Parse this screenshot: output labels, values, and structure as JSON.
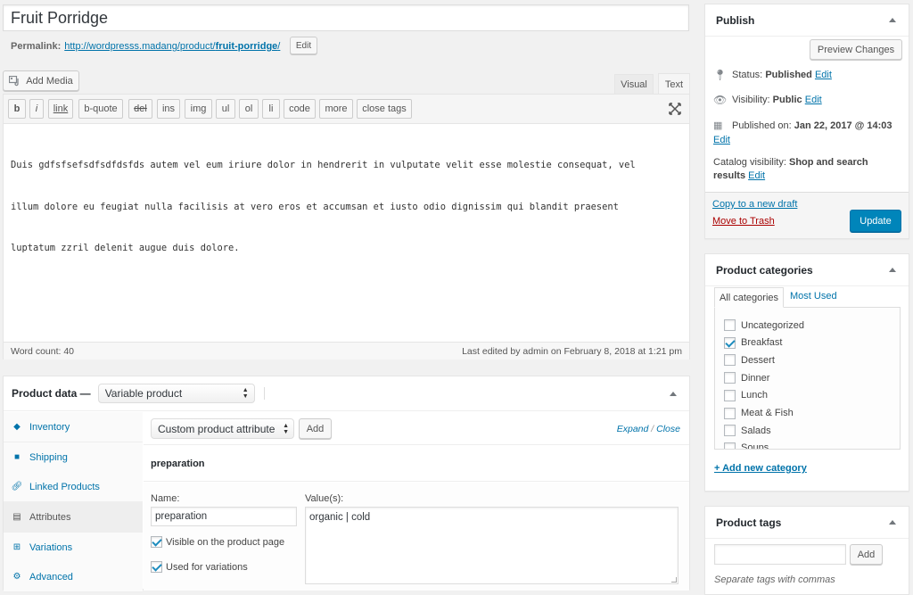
{
  "title_input": {
    "value": "Fruit Porridge"
  },
  "permalink": {
    "label": "Permalink:",
    "url_base": "http://wordpresss.madang/product/",
    "slug": "fruit-porridge",
    "trailing": "/",
    "edit_label": "Edit"
  },
  "editor": {
    "add_media_label": "Add Media",
    "tabs": [
      {
        "label": "Visual",
        "active": false
      },
      {
        "label": "Text",
        "active": true
      }
    ],
    "quicktags": [
      "b",
      "i",
      "link",
      "b-quote",
      "del",
      "ins",
      "img",
      "ul",
      "ol",
      "li",
      "code",
      "more",
      "close tags"
    ],
    "content_lines": [
      "Duis gdfsfsefsdfsdfdsfds autem vel eum iriure dolor in hendrerit in vulputate velit esse molestie consequat, vel",
      "illum dolore eu feugiat nulla facilisis at vero eros et accumsan et iusto odio dignissim qui blandit praesent",
      "luptatum zzril delenit augue duis dolore."
    ],
    "word_count": "Word count: 40",
    "last_edited": "Last edited by admin on February 8, 2018 at 1:21 pm"
  },
  "product_data": {
    "label": "Product data —",
    "type_select": "Variable product",
    "tabs": [
      {
        "label": "Inventory",
        "icon": "inventory-icon",
        "active": false
      },
      {
        "label": "Shipping",
        "icon": "truck-icon",
        "active": false
      },
      {
        "label": "Linked Products",
        "icon": "link-icon",
        "active": false
      },
      {
        "label": "Attributes",
        "icon": "list-icon",
        "active": true
      },
      {
        "label": "Variations",
        "icon": "grid-icon",
        "active": false
      },
      {
        "label": "Advanced",
        "icon": "gear-icon",
        "active": false
      }
    ],
    "attribute_select": "Custom product attribute",
    "add_label": "Add",
    "expand_label": "Expand",
    "separator": "/",
    "close_label": "Close",
    "attribute": {
      "heading": "preparation",
      "name_label": "Name:",
      "name_value": "preparation",
      "values_label": "Value(s):",
      "values_value": "organic | cold",
      "visible_label": "Visible on the product page",
      "visible_checked": true,
      "variations_label": "Used for variations",
      "variations_checked": true
    }
  },
  "publish": {
    "title": "Publish",
    "preview_label": "Preview Changes",
    "status_label": "Status:",
    "status_value": "Published",
    "visibility_label": "Visibility:",
    "visibility_value": "Public",
    "published_label": "Published on:",
    "published_value": "Jan 22, 2017 @ 14:03",
    "catalog_label": "Catalog visibility:",
    "catalog_value_1": "Shop and search",
    "catalog_value_2": "results",
    "edit_label": "Edit",
    "copy_label": "Copy to a new draft",
    "trash_label": "Move to Trash",
    "update_label": "Update"
  },
  "categories": {
    "title": "Product categories",
    "tabs": [
      {
        "label": "All categories",
        "active": true
      },
      {
        "label": "Most Used",
        "active": false
      }
    ],
    "items": [
      {
        "label": "Uncategorized",
        "checked": false
      },
      {
        "label": "Breakfast",
        "checked": true
      },
      {
        "label": "Dessert",
        "checked": false
      },
      {
        "label": "Dinner",
        "checked": false
      },
      {
        "label": "Lunch",
        "checked": false
      },
      {
        "label": "Meat & Fish",
        "checked": false
      },
      {
        "label": "Salads",
        "checked": false
      },
      {
        "label": "Soups",
        "checked": false
      }
    ],
    "add_new_label": "+ Add new category"
  },
  "tags": {
    "title": "Product tags",
    "input_value": "",
    "add_label": "Add",
    "hint": "Separate tags with commas"
  },
  "colors": {
    "link": "#0073aa",
    "primary_button": "#0085ba",
    "trash": "#a00",
    "background": "#f1f1f1"
  }
}
